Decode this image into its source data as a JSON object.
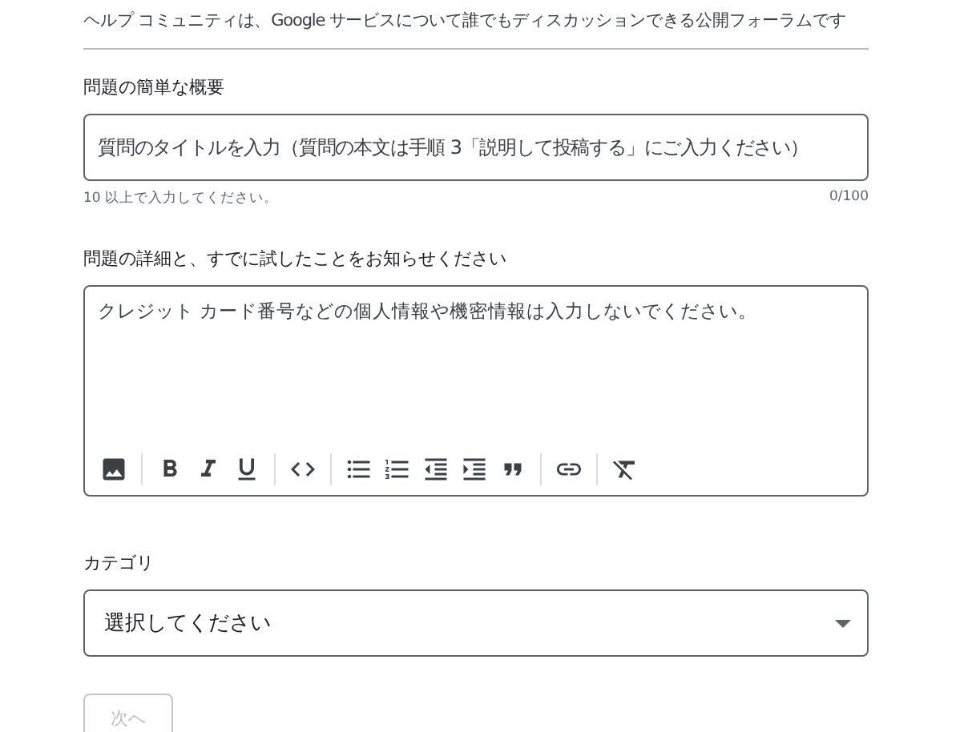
{
  "intro": "ヘルプ コミュニティは、Google サービスについて誰でもディスカッションできる公開フォーラムです",
  "summary": {
    "label": "問題の簡単な概要",
    "placeholder": "質問のタイトルを入力（質問の本文は手順 3「説明して投稿する」にご入力ください）",
    "hint": "10 以上で入力してください。",
    "counter": "0/100"
  },
  "details": {
    "label": "問題の詳細と、すでに試したことをお知らせください",
    "placeholder": "クレジット カード番号などの個人情報や機密情報は入力しないでください。"
  },
  "category": {
    "label": "カテゴリ",
    "value": "選択してください"
  },
  "next_button": {
    "label": "次へ",
    "disabled": true
  }
}
